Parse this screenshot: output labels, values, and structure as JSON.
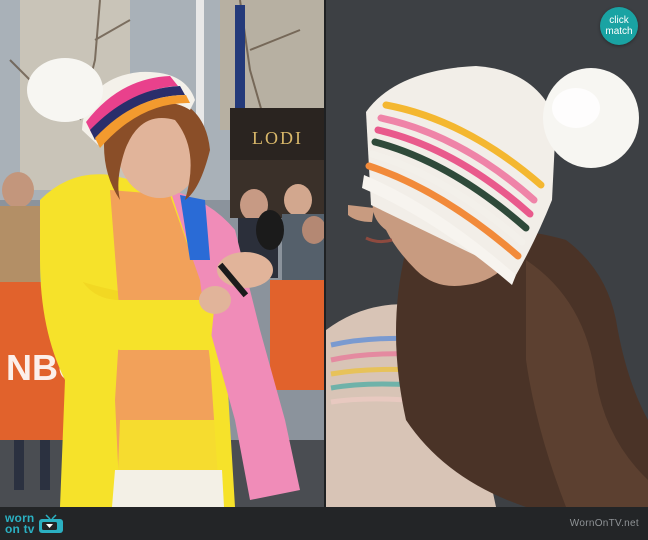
{
  "left_panel": {
    "storefront_sign": "LODI",
    "sign_backdrop": "NBC"
  },
  "badge": {
    "line1": "click",
    "line2": "match"
  },
  "footer": {
    "logo_line1": "worn",
    "logo_line2": "on tv",
    "watermark": "WornOnTV.net"
  },
  "colors": {
    "badge": "#1aa3a3",
    "logo": "#2bb0c2",
    "coat": "#f6e22a",
    "scarf_pink": "#f08cb8",
    "scarf_orange": "#f2a15a"
  }
}
